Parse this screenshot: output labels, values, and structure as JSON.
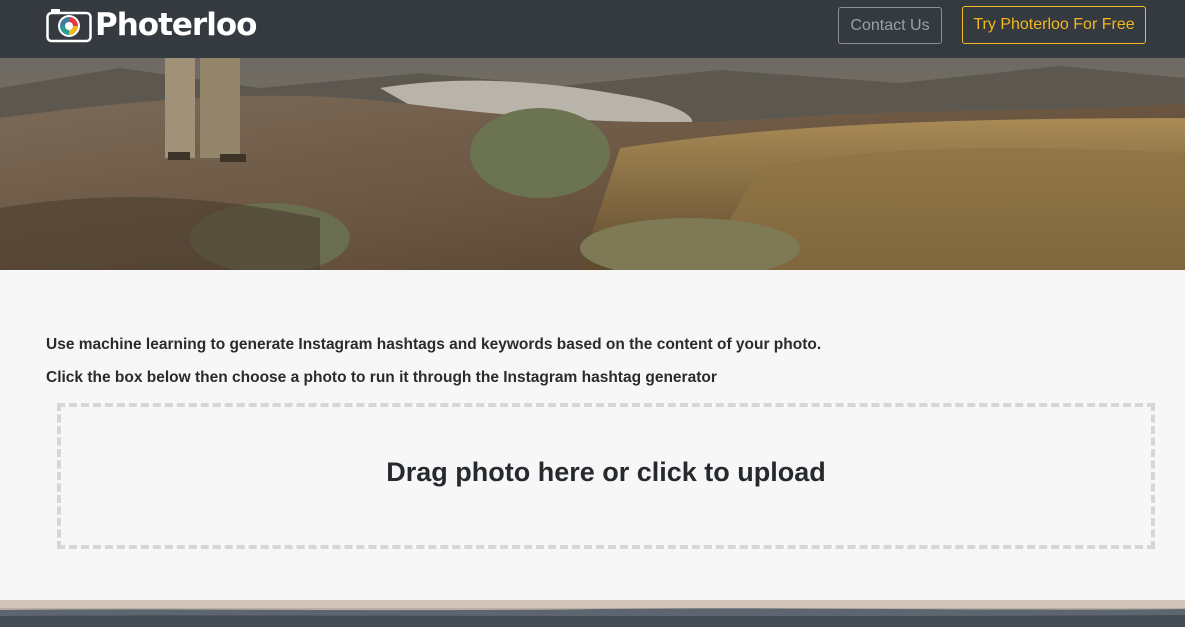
{
  "header": {
    "brand_name": "Photerloo",
    "logo_icon": "camera-logo-icon",
    "contact_label": "Contact Us",
    "try_label": "Try Photerloo For Free"
  },
  "hero": {
    "image": "landscape-photo"
  },
  "main": {
    "intro_line_1": "Use machine learning to generate Instagram hashtags and keywords based on the content of your photo.",
    "intro_line_2": "Click the box below then choose a photo to run it through the Instagram hashtag generator",
    "dropzone_label": "Drag photo here or click to upload"
  },
  "colors": {
    "navbar": "#343a40",
    "accent": "#f3b81f",
    "background": "#f7f7f7"
  }
}
